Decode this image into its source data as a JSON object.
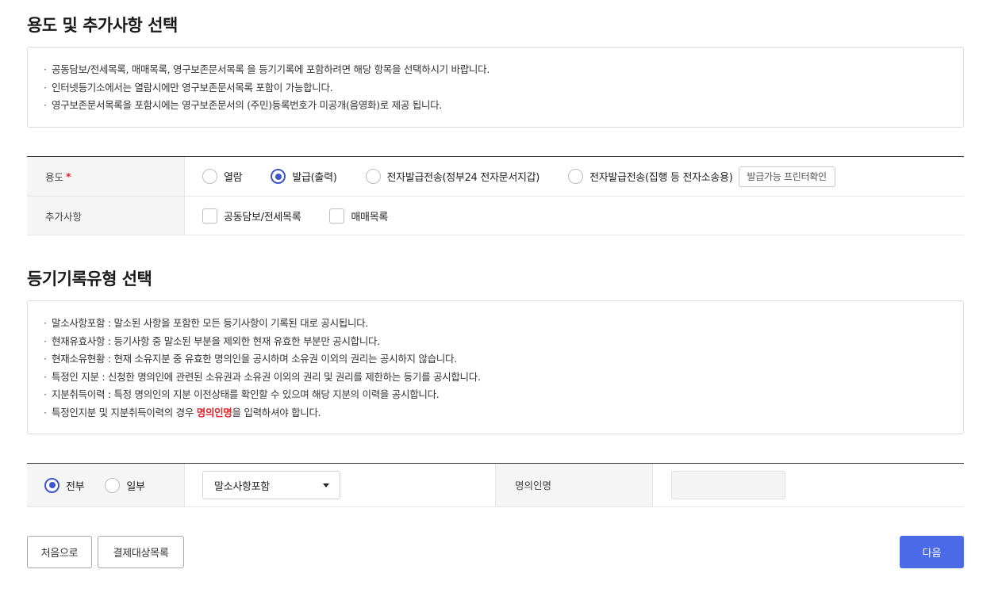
{
  "section1": {
    "title": "용도 및 추가사항 선택",
    "notices": [
      "공동담보/전세목록, 매매목록, 영구보존문서목록 을 등기기록에 포함하려면 해당 항목을 선택하시기 바랍니다.",
      "인터넷등기소에서는 열람시에만 영구보존문서목록 포함이 가능합니다.",
      "영구보존문서목록을 포함시에는 영구보존문서의 (주민)등록번호가 미공개(음영화)로 제공 됩니다."
    ]
  },
  "purpose": {
    "label": "용도",
    "required_mark": "*",
    "options": [
      "열람",
      "발급(출력)",
      "전자발급전송(정부24 전자문서지갑)",
      "전자발급전송(집행 등 전자소송용)"
    ],
    "selected": "발급(출력)",
    "printer_check_label": "발급가능 프린터확인"
  },
  "extras": {
    "label": "추가사항",
    "options": [
      "공동담보/전세목록",
      "매매목록"
    ]
  },
  "section2": {
    "title": "등기기록유형 선택",
    "notices": [
      "말소사항포함 : 말소된 사항을 포함한 모든 등기사항이 기록된 대로 공시됩니다.",
      "현재유효사항 : 등기사항 중 말소된 부분을 제외한 현재 유효한 부분만 공시합니다.",
      "현재소유현황 : 현재 소유지분 중 유효한 명의인을 공시하며 소유권 이외의 권리는 공시하지 않습니다.",
      "특정인 지분 : 신청한 명의인에 관련된 소유권과 소유권 이외의 권리 및 권리를 제한하는 등기를 공시합니다.",
      "지분취득이력 : 특정 명의인의 지분 이전상태를 확인할 수 있으며 해당 지분의 이력을 공시합니다."
    ],
    "last_notice": {
      "prefix": "특정인지분 및 지분취득이력의 경우 ",
      "highlight": "명의인명",
      "suffix": "을 입력하셔야 합니다."
    }
  },
  "record_type": {
    "scope_options": [
      "전부",
      "일부"
    ],
    "scope_selected": "전부",
    "type_selected": "말소사항포함",
    "name_label": "명의인명",
    "name_value": ""
  },
  "buttons": {
    "home": "처음으로",
    "payment_list": "결제대상목록",
    "next": "다음"
  },
  "colors": {
    "accent": "#3d56c9",
    "primary_button": "#4a6ae8",
    "required": "#e0262c"
  }
}
